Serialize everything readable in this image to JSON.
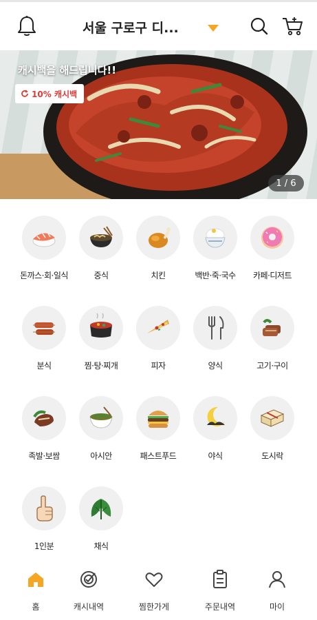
{
  "header": {
    "location": "서울 구로구 디...",
    "icons": [
      "bell-icon",
      "chevron-down-icon",
      "search-icon",
      "cart-icon"
    ],
    "accent_color": "#f5a623"
  },
  "banner": {
    "headline": "캐시백을 해드립니다!!",
    "badge": "10% 캐시백",
    "page_indicator": "1 / 6",
    "badge_color": "#e53935"
  },
  "categories": [
    {
      "label": "돈까스·회·일식",
      "icon": "sushi-icon"
    },
    {
      "label": "중식",
      "icon": "noodle-bowl-icon"
    },
    {
      "label": "치킨",
      "icon": "chicken-icon"
    },
    {
      "label": "백반·죽·국수",
      "icon": "rice-bowl-icon"
    },
    {
      "label": "카페·디저트",
      "icon": "donut-icon"
    },
    {
      "label": "분식",
      "icon": "sausage-icon"
    },
    {
      "label": "찜·탕·찌개",
      "icon": "stew-pot-icon"
    },
    {
      "label": "피자",
      "icon": "pizza-icon"
    },
    {
      "label": "양식",
      "icon": "fork-knife-icon"
    },
    {
      "label": "고기·구이",
      "icon": "meat-icon"
    },
    {
      "label": "족발·보쌈",
      "icon": "pork-icon"
    },
    {
      "label": "아시안",
      "icon": "asian-bowl-icon"
    },
    {
      "label": "패스트푸드",
      "icon": "burger-icon"
    },
    {
      "label": "야식",
      "icon": "moon-icon"
    },
    {
      "label": "도시락",
      "icon": "lunchbox-icon"
    },
    {
      "label": "1인분",
      "icon": "one-finger-icon"
    },
    {
      "label": "채식",
      "icon": "leaf-icon"
    }
  ],
  "bottom_nav": [
    {
      "label": "홈",
      "icon": "home-icon",
      "active": true
    },
    {
      "label": "캐시내역",
      "icon": "cash-history-icon",
      "active": false
    },
    {
      "label": "찜한가게",
      "icon": "heart-icon",
      "active": false
    },
    {
      "label": "주문내역",
      "icon": "order-list-icon",
      "active": false
    },
    {
      "label": "마이",
      "icon": "user-icon",
      "active": false
    }
  ]
}
